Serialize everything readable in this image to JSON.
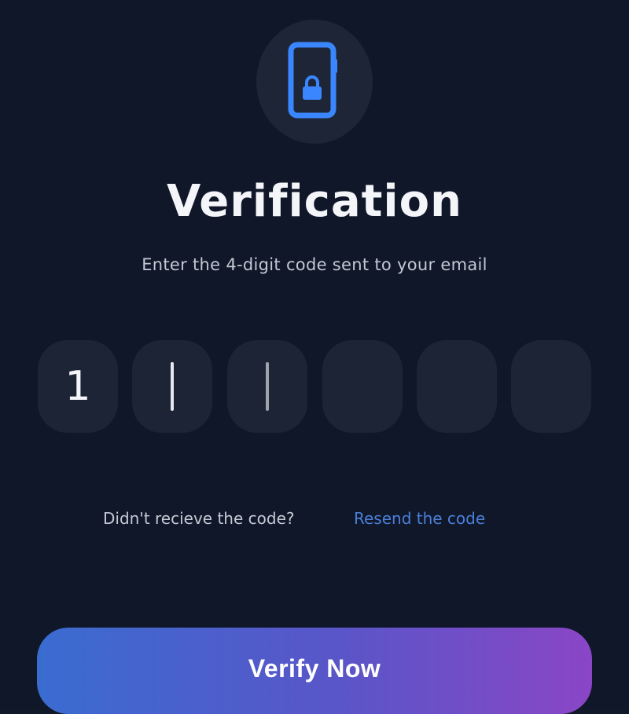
{
  "header": {
    "title": "Verification",
    "subtitle": "Enter the 4-digit code sent to your email",
    "icon": "phone-lock-icon"
  },
  "otp": {
    "digits": [
      "1",
      "",
      "",
      "",
      "",
      ""
    ]
  },
  "resend": {
    "prompt": "Didn't recieve the code?",
    "link_label": "Resend the code"
  },
  "actions": {
    "verify_label": "Verify Now"
  },
  "colors": {
    "background": "#0f1729",
    "input_bg": "#1d2436",
    "accent_link": "#4c7fd9",
    "icon_blue": "#3a86ff",
    "button_gradient_start": "#3a6cd0",
    "button_gradient_end": "#8a46c6"
  }
}
